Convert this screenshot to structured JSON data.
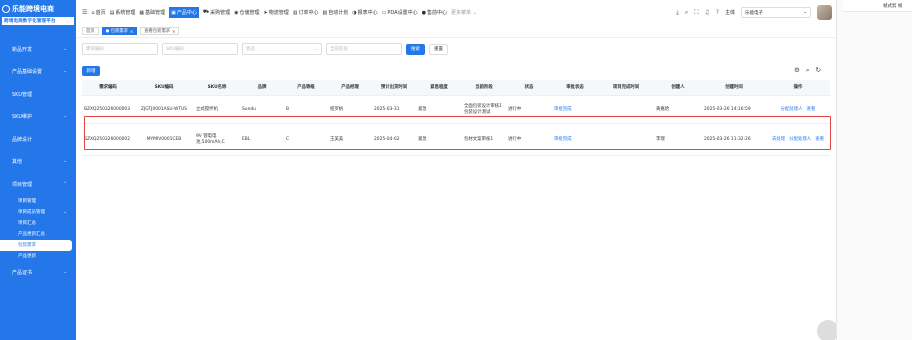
{
  "brand": {
    "title": "乐能跨境电商",
    "subtitle": "跨境电商数字化管理平台"
  },
  "sidebar": {
    "items": [
      {
        "label": "新品开发",
        "chevron": "⌄"
      },
      {
        "label": "产品基础设置",
        "chevron": "⌄"
      },
      {
        "label": "SKU管理",
        "chevron": ""
      },
      {
        "label": "SKU维护",
        "chevron": "⌄"
      },
      {
        "label": "品牌设计",
        "chevron": ""
      },
      {
        "label": "其他",
        "chevron": "⌄"
      },
      {
        "label": "项目管理",
        "chevron": "⌃"
      }
    ],
    "sub": [
      {
        "label": "项目管理",
        "chevron": ""
      },
      {
        "label": "项目成员管理",
        "chevron": "⌄"
      },
      {
        "label": "项目汇总",
        "chevron": ""
      },
      {
        "label": "产品更新汇总",
        "chevron": ""
      },
      {
        "label": "包装需求",
        "chevron": ""
      },
      {
        "label": "产品更新",
        "chevron": ""
      }
    ],
    "last": {
      "label": "产品证书",
      "chevron": "⌄"
    }
  },
  "topnav": [
    {
      "icon": "⌂",
      "label": "首页"
    },
    {
      "icon": "▤",
      "label": "系统管理"
    },
    {
      "icon": "▦",
      "label": "基础管理"
    },
    {
      "icon": "▣",
      "label": "产品中心"
    },
    {
      "icon": "⛟",
      "label": "采购管理"
    },
    {
      "icon": "◉",
      "label": "仓储管理"
    },
    {
      "icon": "➤",
      "label": "物流管理"
    },
    {
      "icon": "▥",
      "label": "订单中心"
    },
    {
      "icon": "▧",
      "label": "自动计划"
    },
    {
      "icon": "◑",
      "label": "报表中心"
    },
    {
      "icon": "▭",
      "label": "PDA设置中心"
    },
    {
      "icon": "●",
      "label": "售前中心"
    },
    {
      "icon": "",
      "label": "更多菜单 ⌄"
    }
  ],
  "header_right": {
    "entity_label": "主体",
    "entity_value": "乐能电子",
    "icons": [
      "⤓",
      "⌕",
      "⛶",
      "♫",
      "?"
    ]
  },
  "tabs": [
    {
      "label": "首页",
      "close": ""
    },
    {
      "label": "● 包装需求",
      "close": "×"
    },
    {
      "label": "查看包装需求",
      "close": "×"
    }
  ],
  "filters": {
    "req_placeholder": "需求编码",
    "sku_placeholder": "SKU编码",
    "status_placeholder": "状态",
    "time_placeholder": "当前阶段",
    "search": "搜索",
    "reset": "重置"
  },
  "add_label": "新增",
  "tool_icons": [
    "⚙",
    "⌕",
    "↻"
  ],
  "table": {
    "headers": [
      "需求编码",
      "SKU编码",
      "SKU名称",
      "品牌",
      "产品等级",
      "产品经理",
      "预计出货时间",
      "紧急程度",
      "当前阶段",
      "状态",
      "审批状态",
      "项目完成时间",
      "创建人",
      "创建时间",
      "操作"
    ],
    "rows": [
      {
        "cells": [
          "BZXQ250326000003",
          "ZJGTJ0001ASU-WTUS",
          "立式搅拌机",
          "Sundu",
          "B",
          "程罗帆",
          "2025-03-31",
          "紧急",
          "全面包装设计审核1 包装设计测试",
          "进行中",
          "审批完成",
          "",
          "黄嘉哈",
          "2025-03-26 14:16:59"
        ],
        "actions": [
          "分配处理人",
          "查看"
        ]
      },
      {
        "cells": [
          "BZXQ250326000002",
          "MYMIV0001CEB",
          "9V 锂电电池,500mAh,C",
          "EBL",
          "C",
          "王美美",
          "2025-04-02",
          "紧急",
          "包材文案审核1",
          "进行中",
          "审批完成",
          "",
          "李理",
          "2025-03-26 11:32:26"
        ],
        "actions": [
          "去处理",
          "分配处理人",
          "查看"
        ]
      }
    ]
  },
  "rpanel": {
    "text": "帧式剪 帧"
  }
}
